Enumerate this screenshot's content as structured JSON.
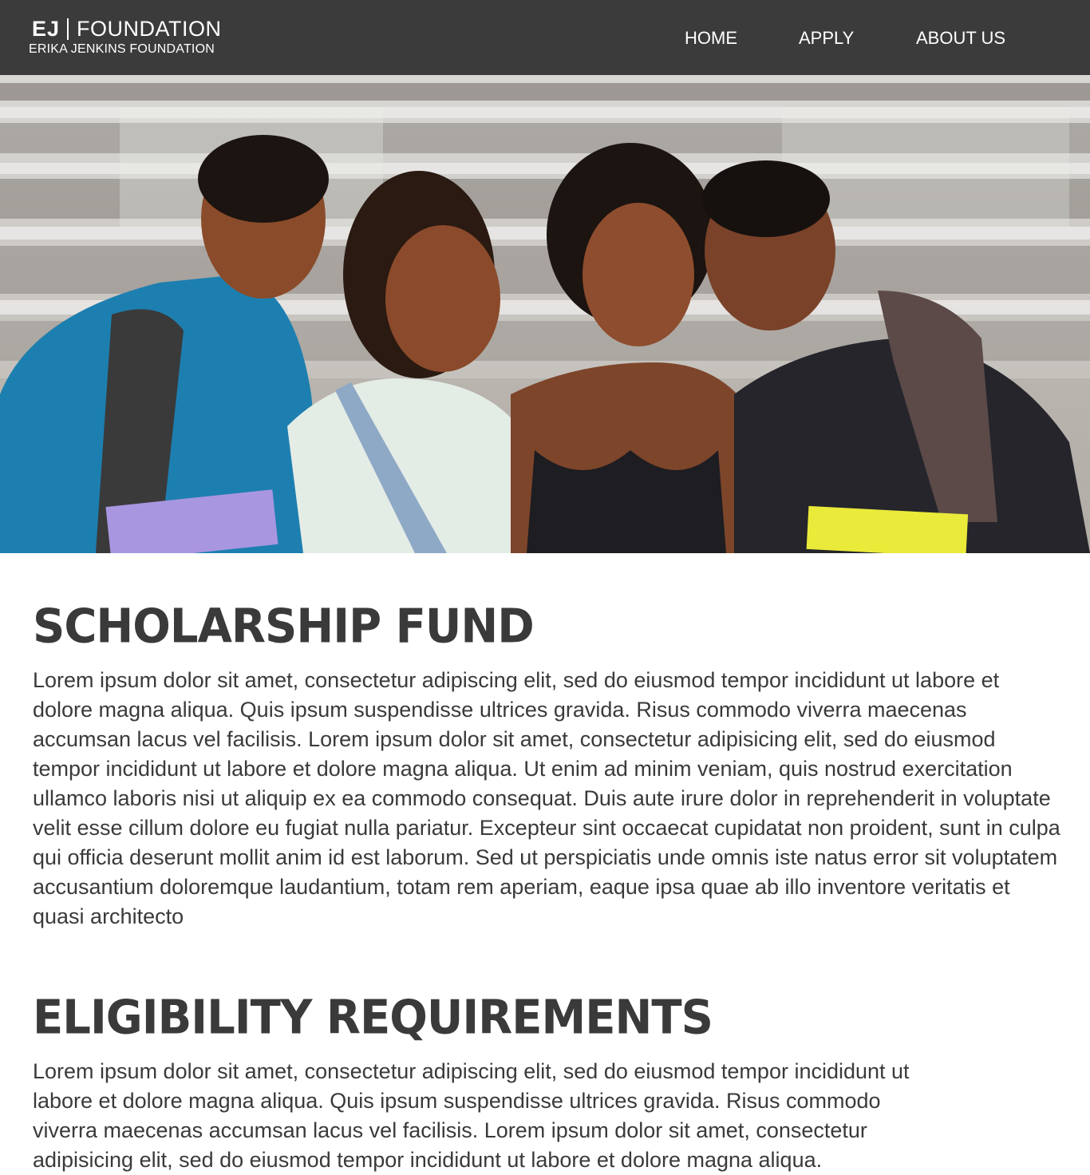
{
  "header": {
    "logo": {
      "mark": "EJ",
      "name": "FOUNDATION",
      "subtitle": "ERIKA JENKINS FOUNDATION"
    },
    "nav": [
      {
        "label": "HOME"
      },
      {
        "label": "APPLY"
      },
      {
        "label": "ABOUT US"
      }
    ],
    "background_color": "#3b3b3b"
  },
  "hero": {
    "image": "photo-four-smiling-students-with-backpacks-and-books"
  },
  "sections": [
    {
      "heading": "SCHOLARSHIP FUND",
      "body": "Lorem ipsum dolor sit amet, consectetur adipiscing elit, sed do eiusmod tempor incididunt ut labore et dolore magna aliqua. Quis ipsum suspendisse ultrices gravida. Risus commodo viverra maecenas accumsan lacus vel facilisis. Lorem ipsum dolor sit amet, consectetur adipisicing elit, sed do eiusmod tempor incididunt ut labore et dolore magna aliqua. Ut enim ad minim veniam, quis nostrud exercitation ullamco laboris nisi ut aliquip ex ea commodo consequat. Duis aute irure dolor in reprehenderit in voluptate velit esse cillum dolore eu fugiat nulla pariatur. Excepteur sint occaecat cupidatat non proident, sunt in culpa qui officia deserunt mollit anim id est laborum. Sed ut perspiciatis unde omnis iste natus error sit voluptatem accusantium doloremque laudantium, totam rem aperiam, eaque ipsa quae ab illo inventore veritatis et quasi architecto"
    },
    {
      "heading": "ELIGIBILITY REQUIREMENTS",
      "body": "Lorem ipsum dolor sit amet, consectetur adipiscing elit, sed do eiusmod tempor incididunt ut labore et dolore magna aliqua. Quis ipsum suspendisse ultrices gravida. Risus commodo viverra maecenas accumsan lacus vel facilisis. Lorem ipsum dolor sit amet, consectetur adipisicing elit, sed do eiusmod tempor incididunt ut labore et dolore magna aliqua."
    }
  ],
  "colors": {
    "text": "#3a3a3a",
    "nav_text": "#ffffff",
    "page_background": "#ffffff"
  }
}
